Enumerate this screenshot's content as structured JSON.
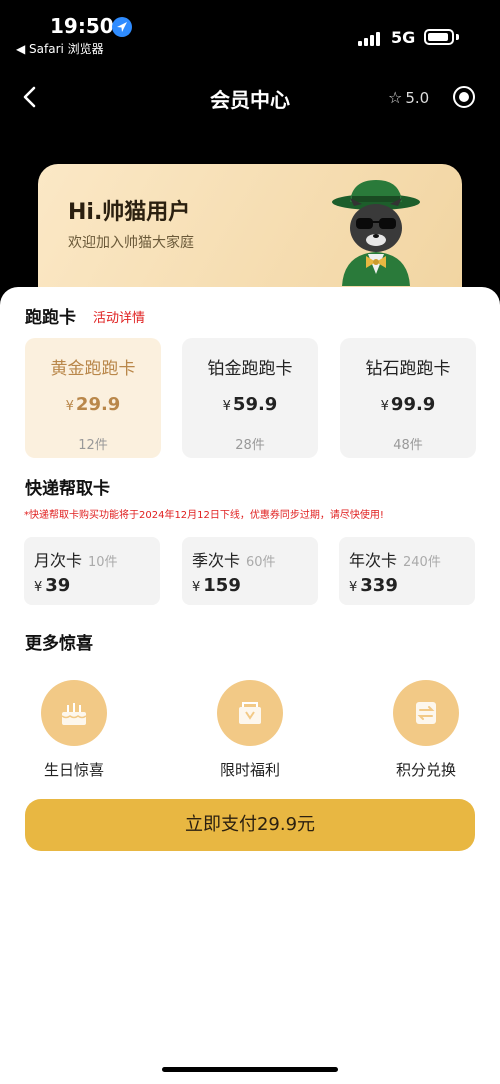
{
  "status_bar": {
    "time": "19:50",
    "back_app": "◀ Safari 浏览器",
    "network": "5G"
  },
  "nav": {
    "title": "会员中心",
    "rating": "5.0"
  },
  "member_card": {
    "greeting": "Hi.帅猫用户",
    "welcome": "欢迎加入帅猫大家庭"
  },
  "run_section": {
    "title": "跑跑卡",
    "activity_link": "活动详情",
    "cards": [
      {
        "name": "黄金跑跑卡",
        "currency": "¥",
        "price": "29.9",
        "count": "12件",
        "selected": true
      },
      {
        "name": "铂金跑跑卡",
        "currency": "¥",
        "price": "59.9",
        "count": "28件",
        "selected": false
      },
      {
        "name": "钻石跑跑卡",
        "currency": "¥",
        "price": "99.9",
        "count": "48件",
        "selected": false
      }
    ]
  },
  "express_section": {
    "title": "快递帮取卡",
    "notice": "*快递帮取卡购买功能将于2024年12月12日下线，优惠券同步过期，请尽快使用!",
    "cards": [
      {
        "name": "月次卡",
        "count": "10件",
        "currency": "¥",
        "price": "39"
      },
      {
        "name": "季次卡",
        "count": "60件",
        "currency": "¥",
        "price": "159"
      },
      {
        "name": "年次卡",
        "count": "240件",
        "currency": "¥",
        "price": "339"
      }
    ]
  },
  "more_section": {
    "title": "更多惊喜",
    "items": [
      {
        "label": "生日惊喜",
        "icon": "birthday-cake-icon"
      },
      {
        "label": "限时福利",
        "icon": "gift-voucher-icon"
      },
      {
        "label": "积分兑换",
        "icon": "exchange-icon"
      }
    ]
  },
  "pay_button": {
    "label": "立即支付29.9元"
  },
  "colors": {
    "accent": "#e8b742",
    "selected_text": "#b9874a",
    "alert": "#e02020"
  }
}
